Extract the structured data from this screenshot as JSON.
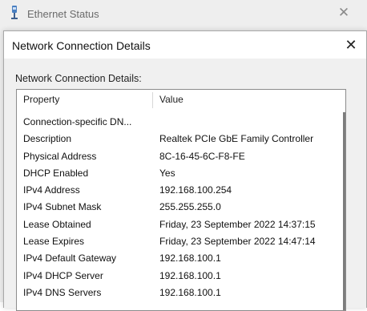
{
  "background_window": {
    "title": "Ethernet Status"
  },
  "dialog": {
    "title": "Network Connection Details",
    "group_label": "Network Connection Details:",
    "columns": {
      "property": "Property",
      "value": "Value"
    },
    "rows": [
      {
        "property": "Connection-specific DN...",
        "value": ""
      },
      {
        "property": "Description",
        "value": "Realtek PCIe GbE Family Controller"
      },
      {
        "property": "Physical Address",
        "value": "8C-16-45-6C-F8-FE"
      },
      {
        "property": "DHCP Enabled",
        "value": "Yes"
      },
      {
        "property": "IPv4 Address",
        "value": "192.168.100.254"
      },
      {
        "property": "IPv4 Subnet Mask",
        "value": "255.255.255.0"
      },
      {
        "property": "Lease Obtained",
        "value": "Friday, 23 September 2022 14:37:15"
      },
      {
        "property": "Lease Expires",
        "value": "Friday, 23 September 2022 14:47:14"
      },
      {
        "property": "IPv4 Default Gateway",
        "value": "192.168.100.1"
      },
      {
        "property": "IPv4 DHCP Server",
        "value": "192.168.100.1"
      },
      {
        "property": "IPv4 DNS Servers",
        "value": "192.168.100.1"
      }
    ]
  }
}
